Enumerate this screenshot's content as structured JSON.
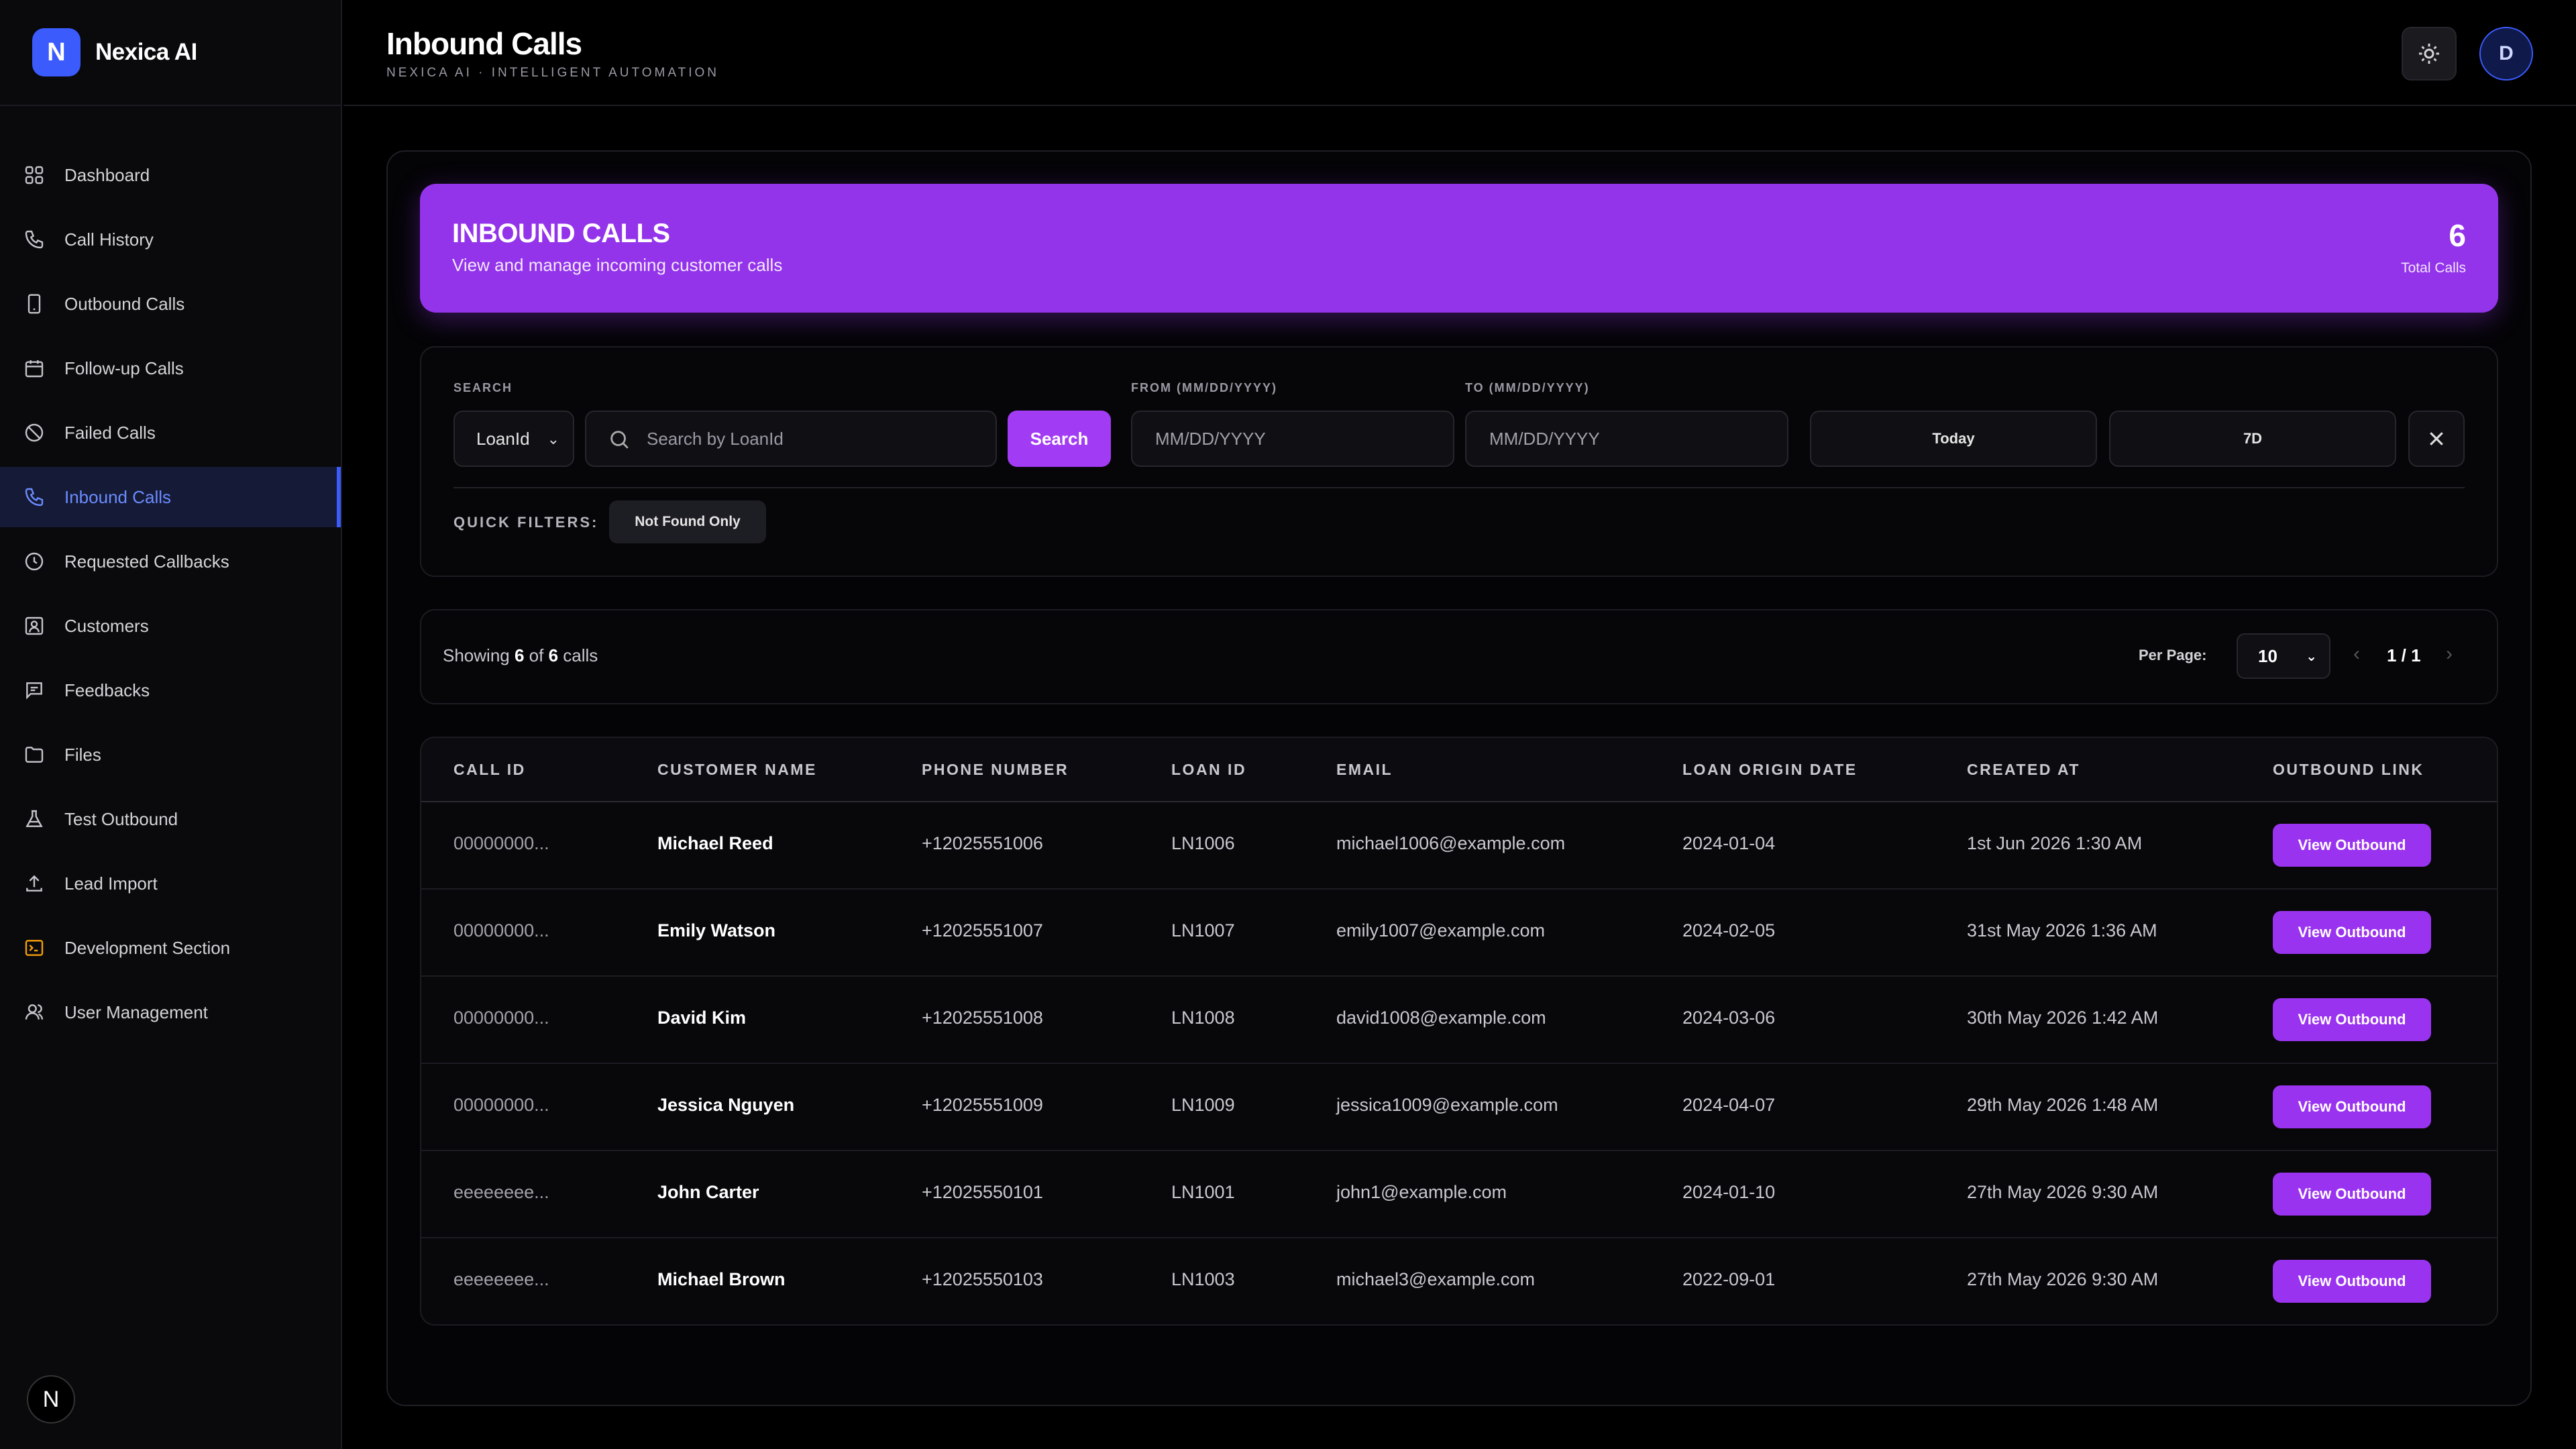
{
  "brand": {
    "logo_letter": "N",
    "name": "Nexica AI",
    "logo_color": "#3b5bfd"
  },
  "sidebar": {
    "items": [
      {
        "label": "Dashboard",
        "icon": "grid-icon"
      },
      {
        "label": "Call History",
        "icon": "phone-icon"
      },
      {
        "label": "Outbound Calls",
        "icon": "mobile-icon"
      },
      {
        "label": "Follow-up Calls",
        "icon": "calendar-icon"
      },
      {
        "label": "Failed Calls",
        "icon": "ban-icon"
      },
      {
        "label": "Inbound Calls",
        "icon": "phone-incoming-icon",
        "active": true
      },
      {
        "label": "Requested Callbacks",
        "icon": "clock-icon"
      },
      {
        "label": "Customers",
        "icon": "contact-icon"
      },
      {
        "label": "Feedbacks",
        "icon": "message-icon"
      },
      {
        "label": "Files",
        "icon": "folder-icon"
      },
      {
        "label": "Test Outbound",
        "icon": "flask-icon"
      },
      {
        "label": "Lead Import",
        "icon": "upload-icon"
      },
      {
        "label": "Development Section",
        "icon": "terminal-icon"
      },
      {
        "label": "User Management",
        "icon": "users-icon"
      }
    ],
    "footer_badge": "N"
  },
  "header": {
    "title": "Inbound Calls",
    "subtitle": "NEXICA AI · INTELLIGENT AUTOMATION",
    "avatar_letter": "D"
  },
  "banner": {
    "title": "INBOUND CALLS",
    "subtitle": "View and manage incoming customer calls",
    "count": "6",
    "count_label": "Total Calls",
    "color": "#9333ea"
  },
  "filters": {
    "search_label": "SEARCH",
    "search_type": "LoanId",
    "search_placeholder": "Search by LoanId",
    "search_button": "Search",
    "from_label": "FROM (MM/DD/YYYY)",
    "from_placeholder": "MM/DD/YYYY",
    "to_label": "TO (MM/DD/YYYY)",
    "to_placeholder": "MM/DD/YYYY",
    "today_button": "Today",
    "seven_day_button": "7D",
    "quick_filters_label": "QUICK FILTERS:",
    "quick_filter_chip": "Not Found Only"
  },
  "pagination": {
    "showing_prefix": "Showing",
    "shown": "6",
    "of": "of",
    "total": "6",
    "suffix": "calls",
    "per_page_label": "Per Page:",
    "per_page": "10",
    "page_indicator": "1 / 1"
  },
  "table": {
    "columns": [
      "CALL ID",
      "CUSTOMER NAME",
      "PHONE NUMBER",
      "LOAN ID",
      "EMAIL",
      "LOAN ORIGIN DATE",
      "CREATED AT",
      "OUTBOUND LINK"
    ],
    "action_label": "View Outbound",
    "rows": [
      {
        "call_id": "00000000...",
        "name": "Michael Reed",
        "phone": "+12025551006",
        "loan_id": "LN1006",
        "email": "michael1006@example.com",
        "origin": "2024-01-04",
        "created": "1st Jun 2026 1:30 AM"
      },
      {
        "call_id": "00000000...",
        "name": "Emily Watson",
        "phone": "+12025551007",
        "loan_id": "LN1007",
        "email": "emily1007@example.com",
        "origin": "2024-02-05",
        "created": "31st May 2026 1:36 AM"
      },
      {
        "call_id": "00000000...",
        "name": "David Kim",
        "phone": "+12025551008",
        "loan_id": "LN1008",
        "email": "david1008@example.com",
        "origin": "2024-03-06",
        "created": "30th May 2026 1:42 AM"
      },
      {
        "call_id": "00000000...",
        "name": "Jessica Nguyen",
        "phone": "+12025551009",
        "loan_id": "LN1009",
        "email": "jessica1009@example.com",
        "origin": "2024-04-07",
        "created": "29th May 2026 1:48 AM"
      },
      {
        "call_id": "eeeeeeee...",
        "name": "John Carter",
        "phone": "+12025550101",
        "loan_id": "LN1001",
        "email": "john1@example.com",
        "origin": "2024-01-10",
        "created": "27th May 2026 9:30 AM"
      },
      {
        "call_id": "eeeeeeee...",
        "name": "Michael Brown",
        "phone": "+12025550103",
        "loan_id": "LN1003",
        "email": "michael3@example.com",
        "origin": "2022-09-01",
        "created": "27th May 2026 9:30 AM"
      }
    ]
  }
}
